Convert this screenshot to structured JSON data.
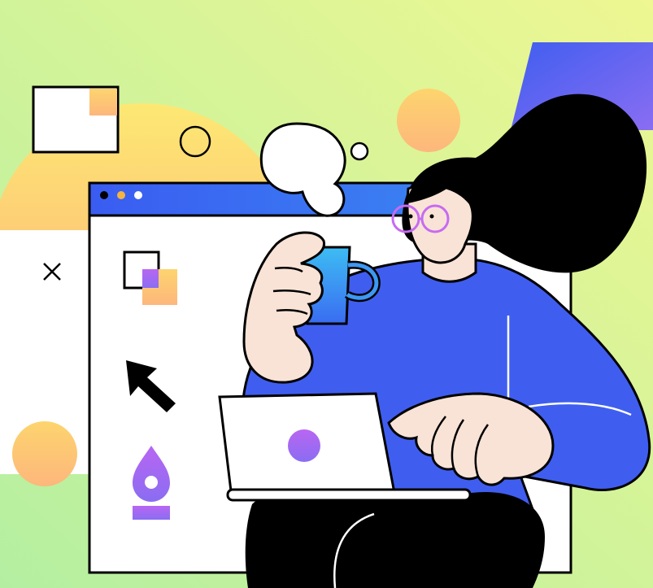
{
  "illustration": {
    "subject": "person-with-coffee-and-laptop",
    "window_dots": [
      "#000000",
      "#f5b340",
      "#ffffff"
    ],
    "icons": [
      "layers-icon",
      "cursor-arrow-icon",
      "pen-nib-icon",
      "close-icon"
    ]
  },
  "colors": {
    "background_start": "#b4efa1",
    "background_end": "#e9f694",
    "sun_top": "#fde873",
    "sun_bottom": "#fda97b",
    "window_titlebar": "#3a5cf1",
    "shirt": "#3f5ef0",
    "skin": "#f9e3d6",
    "hair": "#000000",
    "glasses": "#c76bf2",
    "mug": "#3d97f3",
    "accent_purple": "#b866f2"
  }
}
